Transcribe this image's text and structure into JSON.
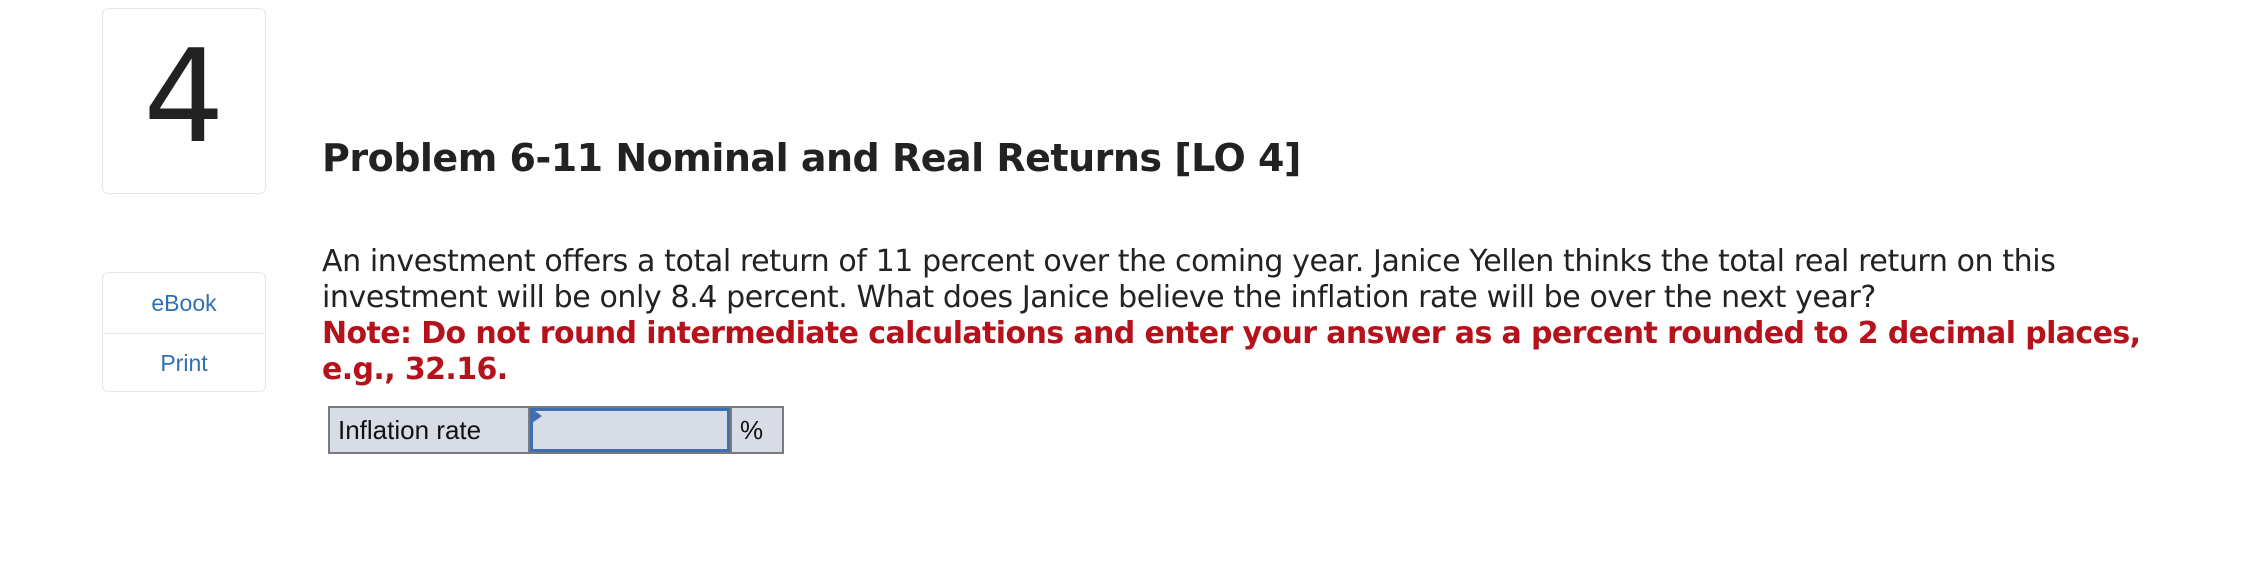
{
  "question": {
    "number": "4"
  },
  "resources": {
    "items": [
      {
        "label": "eBook"
      },
      {
        "label": "Print"
      }
    ]
  },
  "problem": {
    "title": "Problem 6-11 Nominal and Real Returns [LO 4]",
    "text": "An investment offers a total return of 11 percent over the coming year. Janice Yellen thinks the total real return on this investment will be only 8.4 percent. What does Janice believe the inflation rate will be over the next year?",
    "note": "Note: Do not round intermediate calculations and enter your answer as a percent rounded to 2 decimal places, e.g., 32.16."
  },
  "answer": {
    "label": "Inflation rate",
    "value": "",
    "unit": "%"
  },
  "colors": {
    "link": "#2f6fb3",
    "note": "#b5121b",
    "input_border": "#3e6fb0",
    "input_background": "#d8dce6"
  }
}
